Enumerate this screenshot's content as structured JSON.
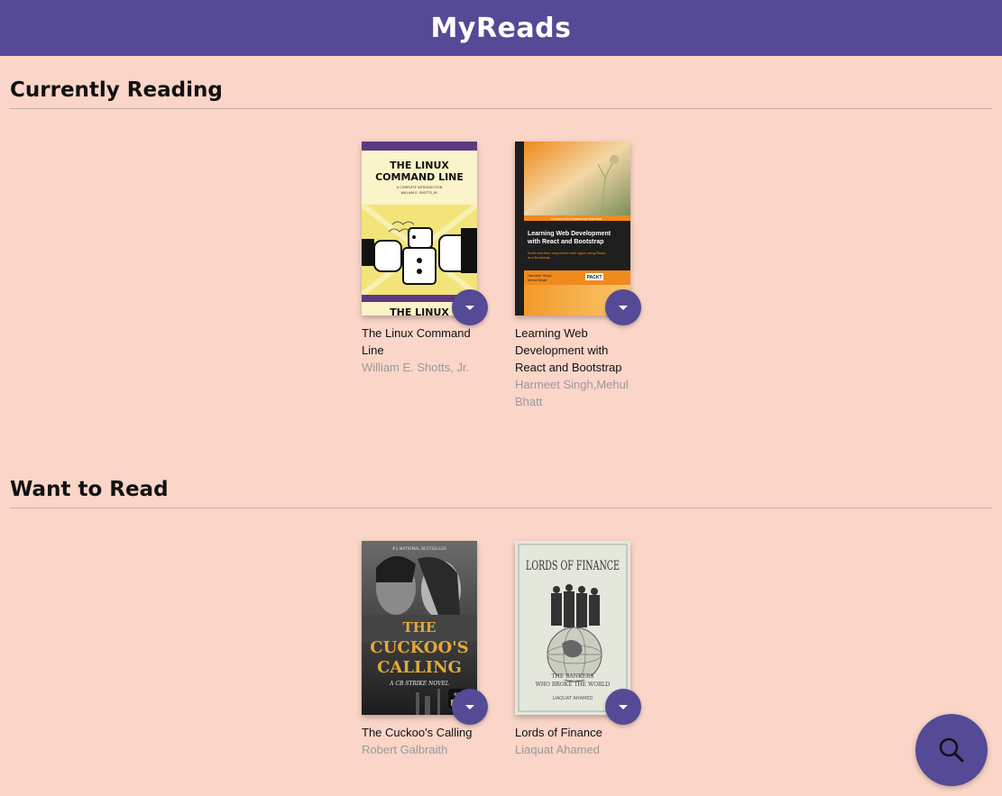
{
  "header": {
    "title": "MyReads"
  },
  "shelves": [
    {
      "title": "Currently Reading",
      "books": [
        {
          "title": "The Linux Command Line",
          "authors": "William E. Shotts, Jr.",
          "cover": {
            "title_line1": "THE LINUX",
            "title_line2": "COMMAND LINE",
            "subtitle": "A COMPLETE INTRODUCTION",
            "author": "WILLIAM E. SHOTTS, JR.",
            "footer": "THE LINUX"
          }
        },
        {
          "title": "Learning Web Development with React and Bootstrap",
          "authors": "Harmeet Singh,Mehul Bhatt",
          "cover": {
            "series": "Community Experience Distilled",
            "title": "Learning Web Development with React and Bootstrap",
            "subtitle": "Build real-time responsive web apps using React and Bootstrap",
            "authors": "Harmeet Singh Mehul Bhatt",
            "publisher": "PACKT"
          }
        }
      ]
    },
    {
      "title": "Want to Read",
      "books": [
        {
          "title": "The Cuckoo's Calling",
          "authors": "Robert Galbraith",
          "cover": {
            "banner": "#1 NATIONAL BESTSELLER",
            "title_line1": "THE",
            "title_line2": "CUCKOO'S",
            "title_line3": "CALLING",
            "subtitle": "A CB STRIKE NOVEL",
            "badge": "NEW S"
          }
        },
        {
          "title": "Lords of Finance",
          "authors": "Liaquat Ahamed",
          "cover": {
            "title": "LORDS OF FINANCE",
            "subtitle_line1": "THE BANKERS",
            "subtitle_line2": "WHO BROKE THE WORLD",
            "author": "LIAQUAT AHAMED"
          }
        }
      ]
    }
  ],
  "colors": {
    "header_bg": "#554a96",
    "page_bg": "#fad5c8",
    "button_bg": "#554a96"
  },
  "icons": {
    "changer": "triangle-down-icon",
    "search": "search-icon"
  }
}
